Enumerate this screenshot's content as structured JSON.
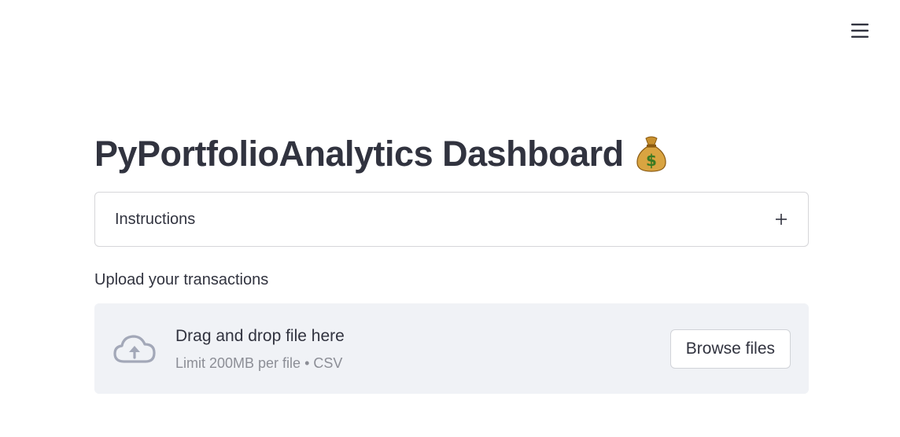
{
  "header": {
    "menu_icon": "hamburger-menu-icon"
  },
  "main": {
    "title": "PyPortfolioAnalytics Dashboard",
    "title_emoji_icon": "money-bag-icon",
    "expander": {
      "label": "Instructions",
      "icon": "plus-icon",
      "expanded": false
    },
    "uploader": {
      "label": "Upload your transactions",
      "icon": "cloud-upload-icon",
      "dropzone_text": "Drag and drop file here",
      "limit_text": "Limit 200MB per file • CSV",
      "browse_label": "Browse files"
    }
  },
  "colors": {
    "text": "#31333f",
    "muted_text": "#8c8e96",
    "dropzone_bg": "#f0f2f6",
    "border": "#d6d6d9",
    "icon": "#a3a8b8"
  }
}
